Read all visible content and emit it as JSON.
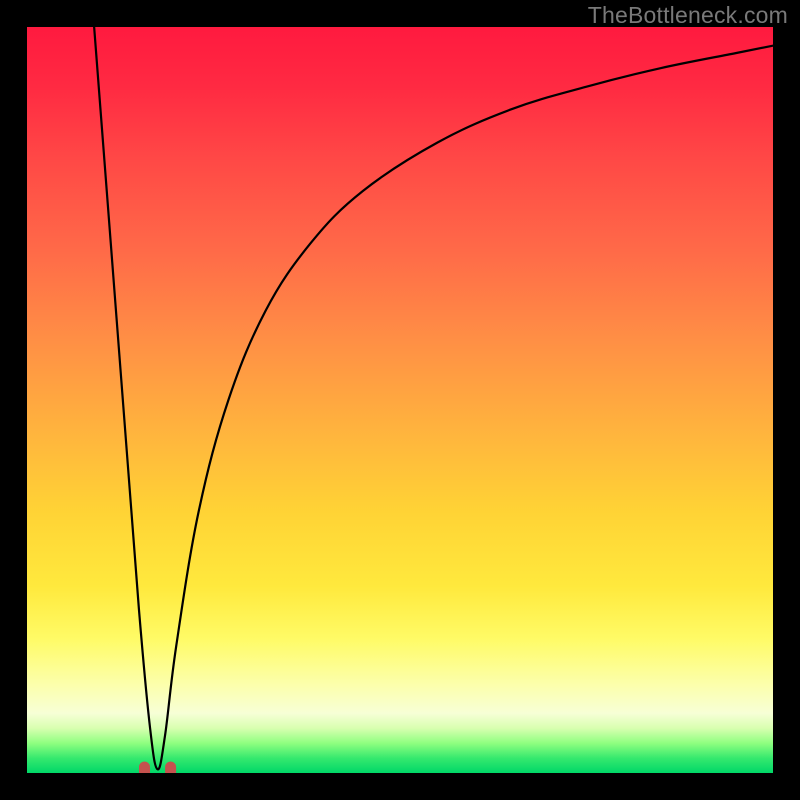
{
  "watermark": "TheBottleneck.com",
  "colors": {
    "frame": "#000000",
    "curve": "#000000",
    "marker_fill": "#c5524e",
    "marker_stroke": "#c5524e"
  },
  "chart_data": {
    "type": "line",
    "title": "",
    "xlabel": "",
    "ylabel": "",
    "xlim": [
      0,
      100
    ],
    "ylim": [
      0,
      100
    ],
    "grid": false,
    "note": "Axes are unlabeled; x/y expressed as 0–100% of plot width/height with y=0 at bottom. Curve appears to be a bottleneck/mismatch curve with minimum near x≈17.5.",
    "series": [
      {
        "name": "mismatch-curve",
        "minimum_x": 17.5,
        "x": [
          9,
          11,
          13,
          15,
          16.5,
          17.5,
          18.5,
          20,
          23,
          27,
          32,
          38,
          45,
          55,
          65,
          75,
          85,
          95,
          100
        ],
        "y": [
          100,
          74,
          48,
          22,
          6,
          0.5,
          5,
          17,
          35,
          50,
          62,
          71,
          78,
          84.5,
          89,
          92,
          94.5,
          96.5,
          97.5
        ]
      }
    ],
    "marker": {
      "name": "optimum-marker",
      "shape": "u",
      "x": 17.5,
      "y": 0.5,
      "width_pct": 3.5,
      "height_pct": 3
    }
  }
}
